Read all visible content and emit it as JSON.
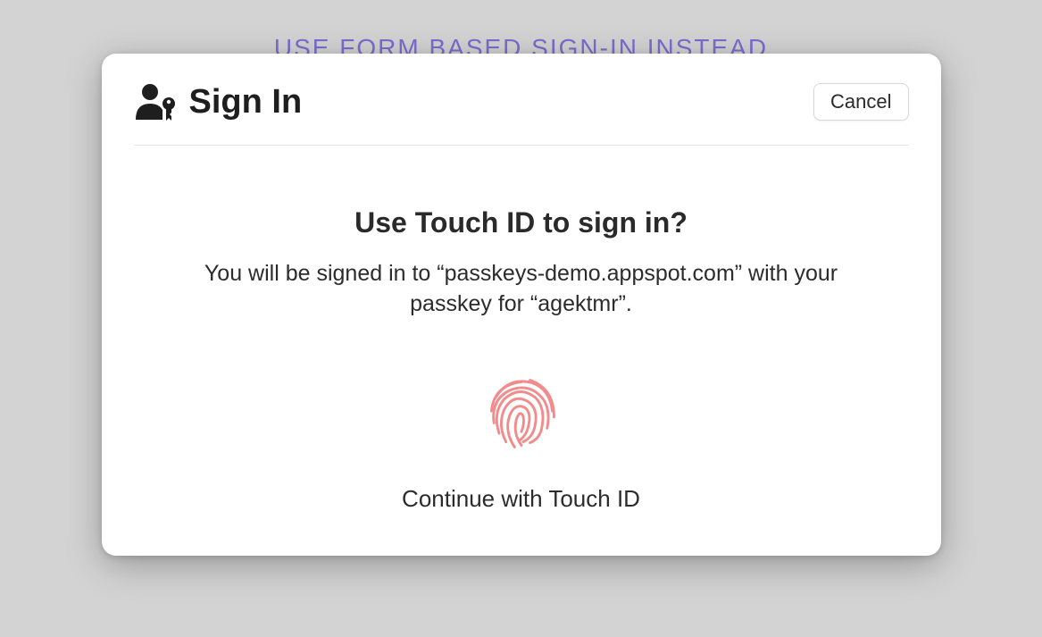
{
  "background": {
    "link_text": "USE FORM BASED SIGN-IN INSTEAD"
  },
  "dialog": {
    "title": "Sign In",
    "cancel_label": "Cancel",
    "prompt_title": "Use Touch ID to sign in?",
    "prompt_description": "You will be signed in to “passkeys-demo.appspot.com” with your passkey for “agektmr”.",
    "continue_label": "Continue with Touch ID"
  },
  "colors": {
    "fingerprint": "#f28b8b",
    "link": "#7b6dcf"
  }
}
